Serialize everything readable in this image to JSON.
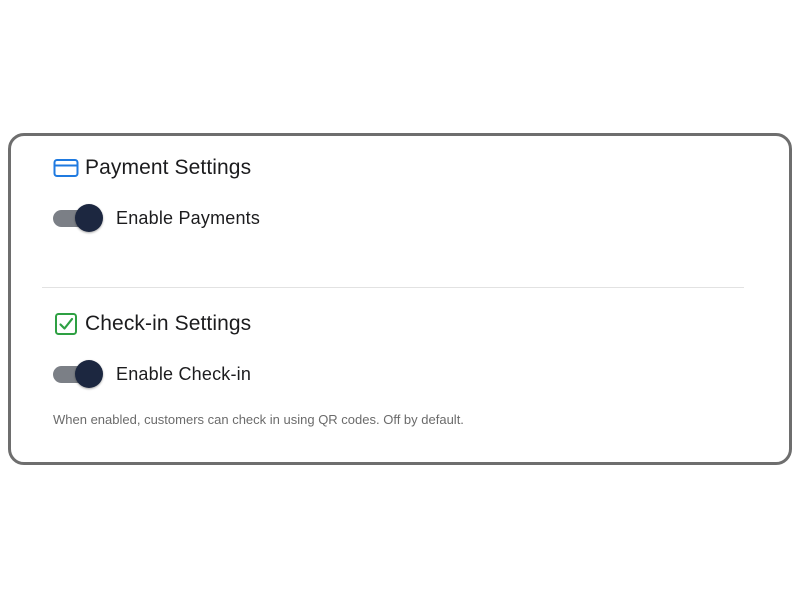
{
  "payment": {
    "icon": "credit-card-icon",
    "icon_color": "#1f7ae0",
    "title": "Payment Settings",
    "toggle": {
      "label": "Enable Payments",
      "enabled": true
    }
  },
  "checkin": {
    "icon": "checkbox-checked-icon",
    "icon_color": "#2ea043",
    "title": "Check-in Settings",
    "toggle": {
      "label": "Enable Check-in",
      "enabled": true
    },
    "help_text": "When enabled, customers can check in using QR codes. Off by default."
  },
  "colors": {
    "toggle_track": "#7b7f86",
    "toggle_knob": "#1c2740",
    "card_border": "#6e6e6e",
    "divider": "#e2e2e2"
  }
}
